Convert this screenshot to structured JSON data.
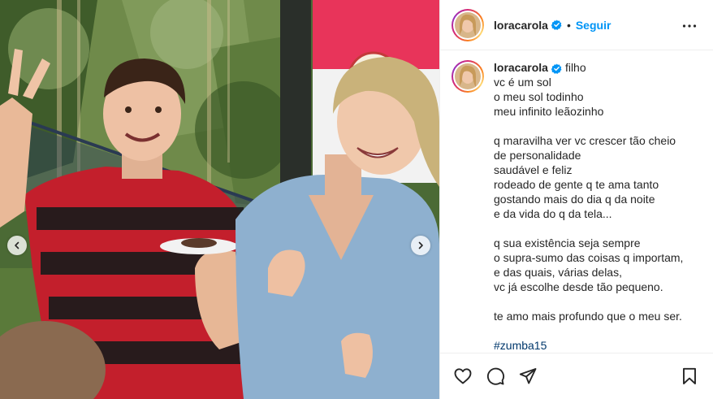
{
  "post": {
    "username": "loracarola",
    "follow_label": "Seguir",
    "separator": "•",
    "caption_first": "filho",
    "caption_lines": [
      "vc é um sol",
      "o meu sol todinho",
      "meu infinito leãozinho",
      "",
      "q maravilha ver vc crescer tão cheio",
      "de personalidade",
      "saudável e feliz",
      "rodeado de gente q te ama tanto",
      "gostando mais do dia q da noite",
      "e da vida do q da tela...",
      "",
      "q sua existência seja sempre",
      "o supra-sumo das coisas q importam,",
      "e das quais, várias delas,",
      "vc já escolhe desde tão pequeno.",
      "",
      "te amo mais profundo que o meu ser.",
      "",
      "#zumba15"
    ]
  },
  "icons": {
    "verified": "verified-badge-icon",
    "more": "more-options-icon",
    "like": "heart-icon",
    "comment": "comment-icon",
    "share": "share-icon",
    "save": "bookmark-icon",
    "prev": "chevron-left-icon",
    "next": "chevron-right-icon"
  },
  "colors": {
    "accent": "#0095f6",
    "verified": "#0095f6",
    "text": "#262626",
    "hashtag": "#00376b",
    "border": "#efefef"
  }
}
